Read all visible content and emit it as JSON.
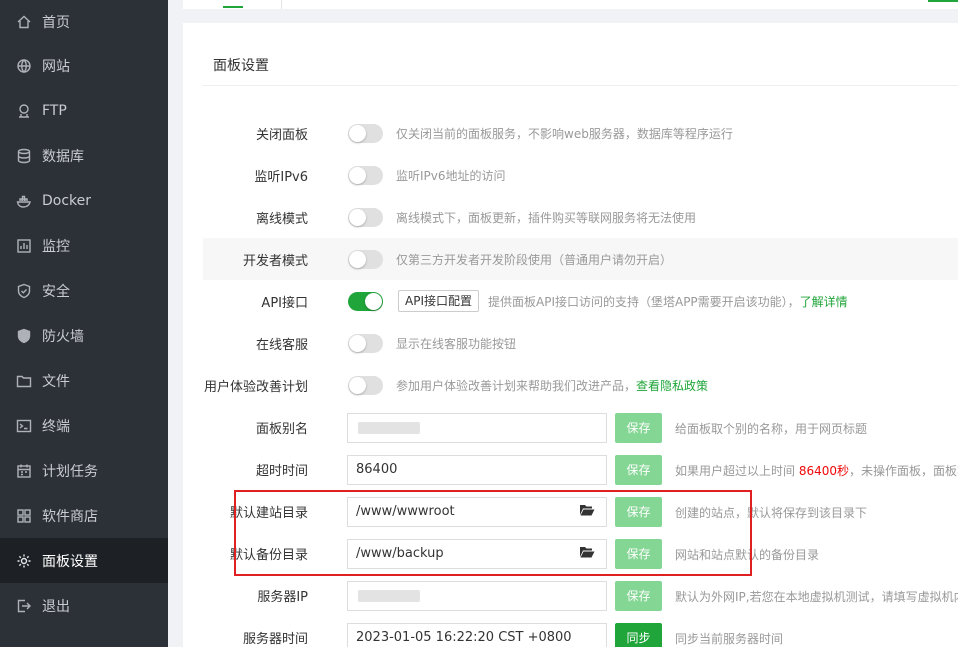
{
  "sidebar": {
    "items": [
      {
        "label": "首页",
        "icon": "home-icon"
      },
      {
        "label": "网站",
        "icon": "globe-icon"
      },
      {
        "label": "FTP",
        "icon": "ftp-icon"
      },
      {
        "label": "数据库",
        "icon": "database-icon"
      },
      {
        "label": "Docker",
        "icon": "docker-icon"
      },
      {
        "label": "监控",
        "icon": "monitor-icon"
      },
      {
        "label": "安全",
        "icon": "shield-icon"
      },
      {
        "label": "防火墙",
        "icon": "firewall-icon"
      },
      {
        "label": "文件",
        "icon": "folder-icon"
      },
      {
        "label": "终端",
        "icon": "terminal-icon"
      },
      {
        "label": "计划任务",
        "icon": "calendar-icon"
      },
      {
        "label": "软件商店",
        "icon": "apps-icon"
      },
      {
        "label": "面板设置",
        "icon": "gear-icon"
      },
      {
        "label": "退出",
        "icon": "logout-icon"
      }
    ],
    "active": "面板设置"
  },
  "panel": {
    "title": "面板设置",
    "rows": {
      "close_panel": {
        "label": "关闭面板",
        "desc": "仅关闭当前的面板服务，不影响web服务器，数据库等程序运行",
        "enabled": false
      },
      "ipv6": {
        "label": "监听IPv6",
        "desc": "监听IPv6地址的访问",
        "enabled": false
      },
      "offline": {
        "label": "离线模式",
        "desc": "离线模式下，面板更新，插件购买等联网服务将无法使用",
        "enabled": false
      },
      "developer": {
        "label": "开发者模式",
        "desc": "仅第三方开发者开发阶段使用（普通用户请勿开启）",
        "enabled": false
      },
      "api": {
        "label": "API接口",
        "button": "API接口配置",
        "desc": "提供面板API接口访问的支持（堡塔APP需要开启该功能），",
        "link": "了解详情",
        "enabled": true
      },
      "online_service": {
        "label": "在线客服",
        "desc": "显示在线客服功能按钮",
        "enabled": false
      },
      "ux_program": {
        "label": "用户体验改善计划",
        "desc": "参加用户体验改善计划来帮助我们改进产品，",
        "link": "查看隐私政策",
        "enabled": false
      },
      "alias": {
        "label": "面板别名",
        "value": "",
        "save": "保存",
        "desc": "给面板取个别的名称，用于网页标题"
      },
      "timeout": {
        "label": "超时时间",
        "value": "86400",
        "save": "保存",
        "desc_prefix": "如果用户超过以上时间 ",
        "desc_value": "86400秒",
        "desc_suffix": "，未操作面板，面板将"
      },
      "site_dir": {
        "label": "默认建站目录",
        "value": "/www/wwwroot",
        "save": "保存",
        "desc": "创建的站点，默认将保存到该目录下"
      },
      "backup_dir": {
        "label": "默认备份目录",
        "value": "/www/backup",
        "save": "保存",
        "desc": "网站和站点默认的备份目录"
      },
      "server_ip": {
        "label": "服务器IP",
        "value": "",
        "save": "保存",
        "desc": "默认为外网IP,若您在本地虚拟机测试，请填写虚拟机内"
      },
      "server_time": {
        "label": "服务器时间",
        "value": "2023-01-05 16:22:20 CST +0800",
        "sync": "同步",
        "desc": "同步当前服务器时间"
      }
    }
  },
  "colors": {
    "accent": "#20a53a",
    "highlight": "#e02020",
    "sidebar_bg": "#2c3138"
  }
}
